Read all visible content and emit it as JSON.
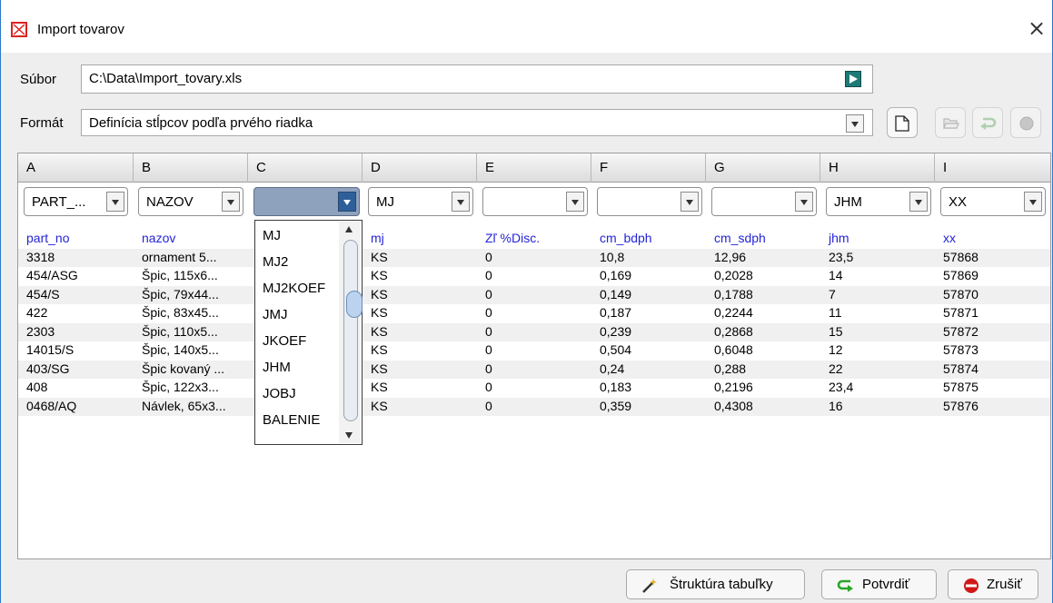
{
  "window": {
    "title": "Import tovarov",
    "close_symbol": "×"
  },
  "file": {
    "label": "Súbor",
    "value": "C:\\Data\\Import_tovary.xls"
  },
  "format": {
    "label": "Formát",
    "value": "Definícia stĺpcov podľa prvého riadka"
  },
  "columns": [
    "A",
    "B",
    "C",
    "D",
    "E",
    "F",
    "G",
    "H",
    "I"
  ],
  "mapping": [
    "PART_...",
    "NAZOV",
    "",
    "MJ",
    "",
    "",
    "",
    "JHM",
    "XX"
  ],
  "field_names": [
    "part_no",
    "nazov",
    "",
    "mj",
    "Zľ %Disc.",
    "cm_bdph",
    "cm_sdph",
    "jhm",
    "xx"
  ],
  "rows": [
    [
      "3318",
      "ornament 5...",
      "",
      "KS",
      "0",
      "10,8",
      "12,96",
      "23,5",
      "57868"
    ],
    [
      "454/ASG",
      "Špic, 115x6...",
      "",
      "KS",
      "0",
      "0,169",
      "0,2028",
      "14",
      "57869"
    ],
    [
      "454/S",
      "Špic, 79x44...",
      "",
      "KS",
      "0",
      "0,149",
      "0,1788",
      "7",
      "57870"
    ],
    [
      "422",
      "Špic, 83x45...",
      "",
      "KS",
      "0",
      "0,187",
      "0,2244",
      "11",
      "57871"
    ],
    [
      "2303",
      "Špic, 110x5...",
      "",
      "KS",
      "0",
      "0,239",
      "0,2868",
      "15",
      "57872"
    ],
    [
      "14015/S",
      "Špic, 140x5...",
      "",
      "KS",
      "0",
      "0,504",
      "0,6048",
      "12",
      "57873"
    ],
    [
      "403/SG",
      "Špic kovaný ...",
      "",
      "KS",
      "0",
      "0,24",
      "0,288",
      "22",
      "57874"
    ],
    [
      "408",
      "Špic, 122x3...",
      "",
      "KS",
      "0",
      "0,183",
      "0,2196",
      "23,4",
      "57875"
    ],
    [
      "0468/AQ",
      "Návlek, 65x3...",
      "",
      "KS",
      "0",
      "0,359",
      "0,4308",
      "16",
      "57876"
    ]
  ],
  "dropdown_options": [
    "MJ",
    "MJ2",
    "MJ2KOEF",
    "JMJ",
    "JKOEF",
    "JHM",
    "JOBJ",
    "BALENIE"
  ],
  "buttons": {
    "structure": "Štruktúra tabuľky",
    "confirm": "Potvrdiť",
    "cancel": "Zrušiť"
  },
  "icons": {
    "app": "import-icon",
    "run": "play-icon",
    "new": "new-document-icon",
    "open": "open-folder-icon",
    "undo": "undo-arrow-icon",
    "clear": "eraser-icon"
  },
  "colors": {
    "field_name": "#2424d8",
    "accent": "#2f5f99",
    "run_button": "#1d7a77"
  }
}
